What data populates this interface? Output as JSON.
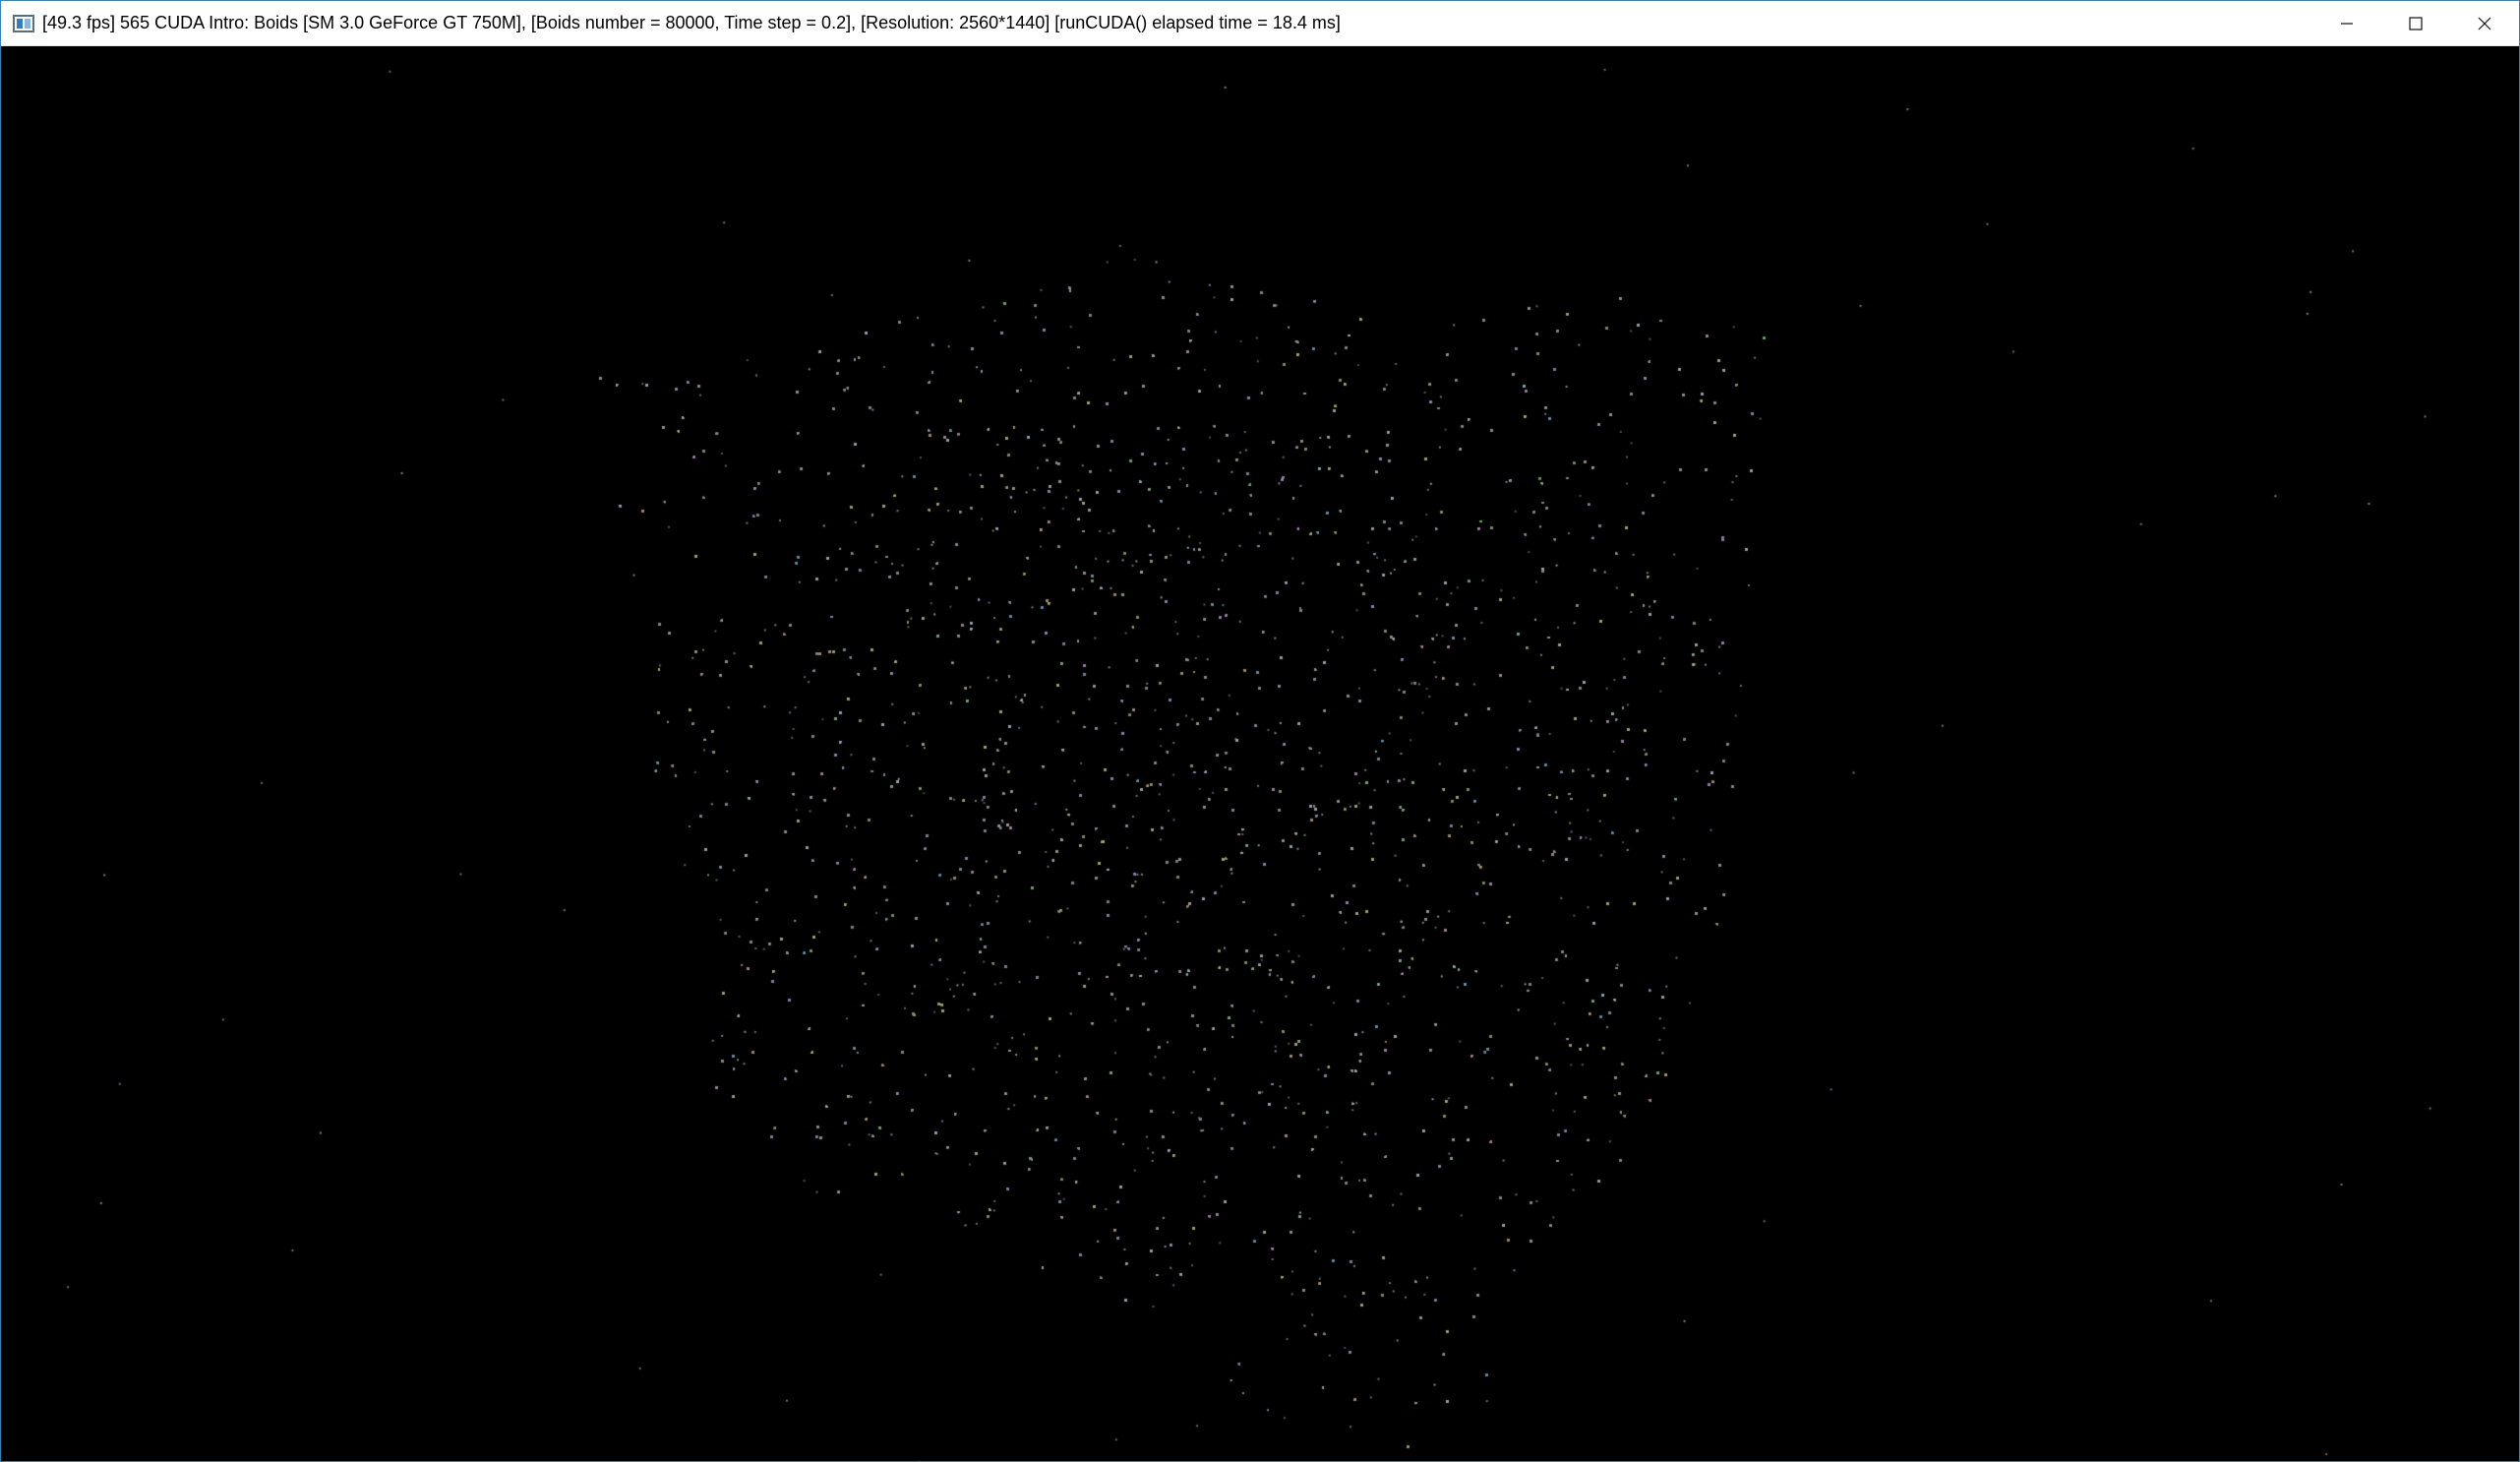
{
  "window": {
    "title": "[49.3 fps] 565 CUDA Intro: Boids [SM 3.0 GeForce GT 750M], [Boids number = 80000, Time step = 0.2], [Resolution: 2560*1440] [runCUDA() elapsed time = 18.4 ms]",
    "app_icon": "window-app-icon",
    "controls": [
      {
        "name": "minimize",
        "icon": "minimize-icon"
      },
      {
        "name": "maximize",
        "icon": "maximize-icon"
      },
      {
        "name": "close",
        "icon": "close-icon"
      }
    ]
  },
  "simulation": {
    "background_color": "#000000",
    "particle_palette": [
      "#7d8f6a",
      "#8a7f8f",
      "#6f8aa0",
      "#a08a7a",
      "#7fa07a",
      "#9a7fa6",
      "#8fa4b0",
      "#a6a07a"
    ]
  }
}
